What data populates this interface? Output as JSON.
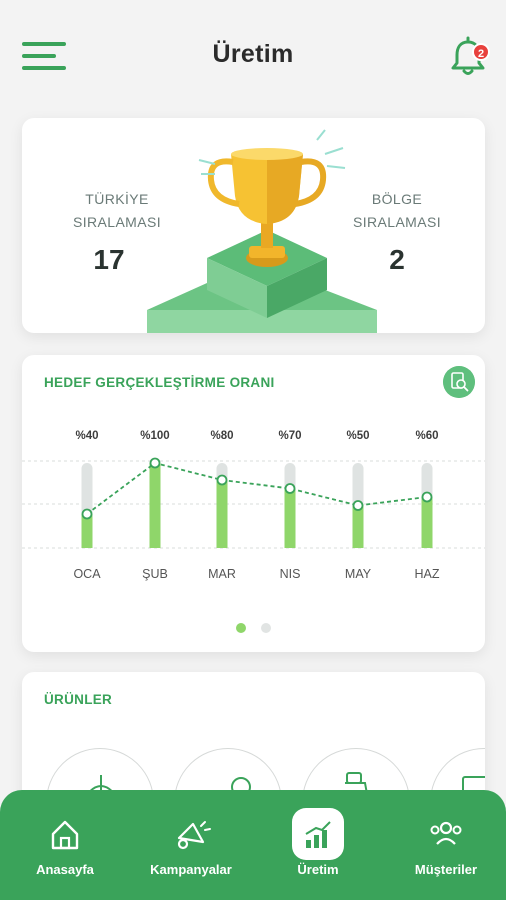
{
  "header": {
    "title": "Üretim",
    "notification_count": "2"
  },
  "ranking": {
    "turkey_label": "TÜRKİYE SIRALAMASI",
    "turkey_value": "17",
    "region_label": "BÖLGE SIRALAMASI",
    "region_value": "2"
  },
  "goal": {
    "title": "HEDEF GERÇEKLEŞTİRME ORANI",
    "percent_labels": [
      "%40",
      "%100",
      "%80",
      "%70",
      "%50",
      "%60"
    ],
    "pagination": {
      "pages": 2,
      "active": 0
    }
  },
  "chart_data": {
    "type": "line",
    "categories": [
      "OCA",
      "ŞUB",
      "MAR",
      "NIS",
      "MAY",
      "HAZ"
    ],
    "series": [
      {
        "values": [
          40,
          100,
          80,
          70,
          50,
          60
        ]
      }
    ],
    "value_labels": [
      "%40",
      "%100",
      "%80",
      "%70",
      "%50",
      "%60"
    ],
    "ylim": [
      0,
      100
    ],
    "grid": true,
    "colors": {
      "line": "#3aa35a",
      "bar_fill": "#8fd66a",
      "bar_track": "#dfe3e2"
    }
  },
  "products": {
    "title": "ÜRÜNLER"
  },
  "bottom_nav": {
    "items": [
      {
        "label": "Anasayfa",
        "icon": "home-icon"
      },
      {
        "label": "Kampanyalar",
        "icon": "megaphone-icon"
      },
      {
        "label": "Üretim",
        "icon": "growth-chart-icon",
        "active": true
      },
      {
        "label": "Müşteriler",
        "icon": "users-icon"
      }
    ]
  },
  "colors": {
    "brand_green": "#3aa35a",
    "badge_red": "#e8413d"
  }
}
